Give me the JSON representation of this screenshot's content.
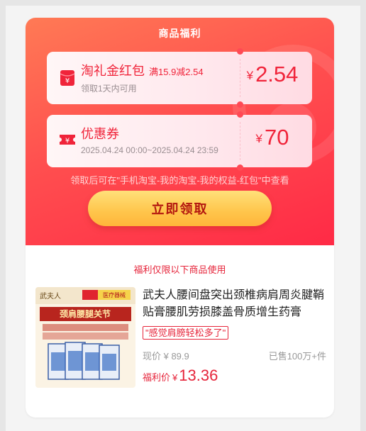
{
  "header": {
    "title": "商品福利"
  },
  "coupons": [
    {
      "name": "淘礼金红包",
      "condition": "满15.9减2.54",
      "sub": "领取1天内可用",
      "currency": "¥",
      "amount": "2.54",
      "icon": "red-envelope-icon"
    },
    {
      "name": "优惠券",
      "condition": "",
      "sub": "2025.04.24 00:00~2025.04.24 23:59",
      "currency": "¥",
      "amount": "70",
      "icon": "coupon-ticket-icon"
    }
  ],
  "notice": "领取后可在\"手机淘宝-我的淘宝-我的权益-红包\"中查看",
  "cta": {
    "label": "立即领取"
  },
  "restriction": "福利仅限以下商品使用",
  "product": {
    "title": "武夫人腰间盘突出颈椎病肩周炎腱鞘贴膏腰肌劳损膝盖骨质增生药膏",
    "tag": "\"感觉肩膀轻松多了\"",
    "original_price": "现价 ¥ 89.9",
    "sold": "已售100万+件",
    "final_label": "福利价",
    "final_currency": "¥",
    "final_price": "13.36",
    "image": {
      "brand": "武夫人",
      "badge": "医疗器械",
      "headline": "颈肩腰腿关节"
    }
  },
  "colors": {
    "accent_red": "#f0243a",
    "header_gradient_start": "#ff7a55",
    "header_gradient_end": "#ff2a46",
    "button_yellow": "#ffc54b"
  }
}
